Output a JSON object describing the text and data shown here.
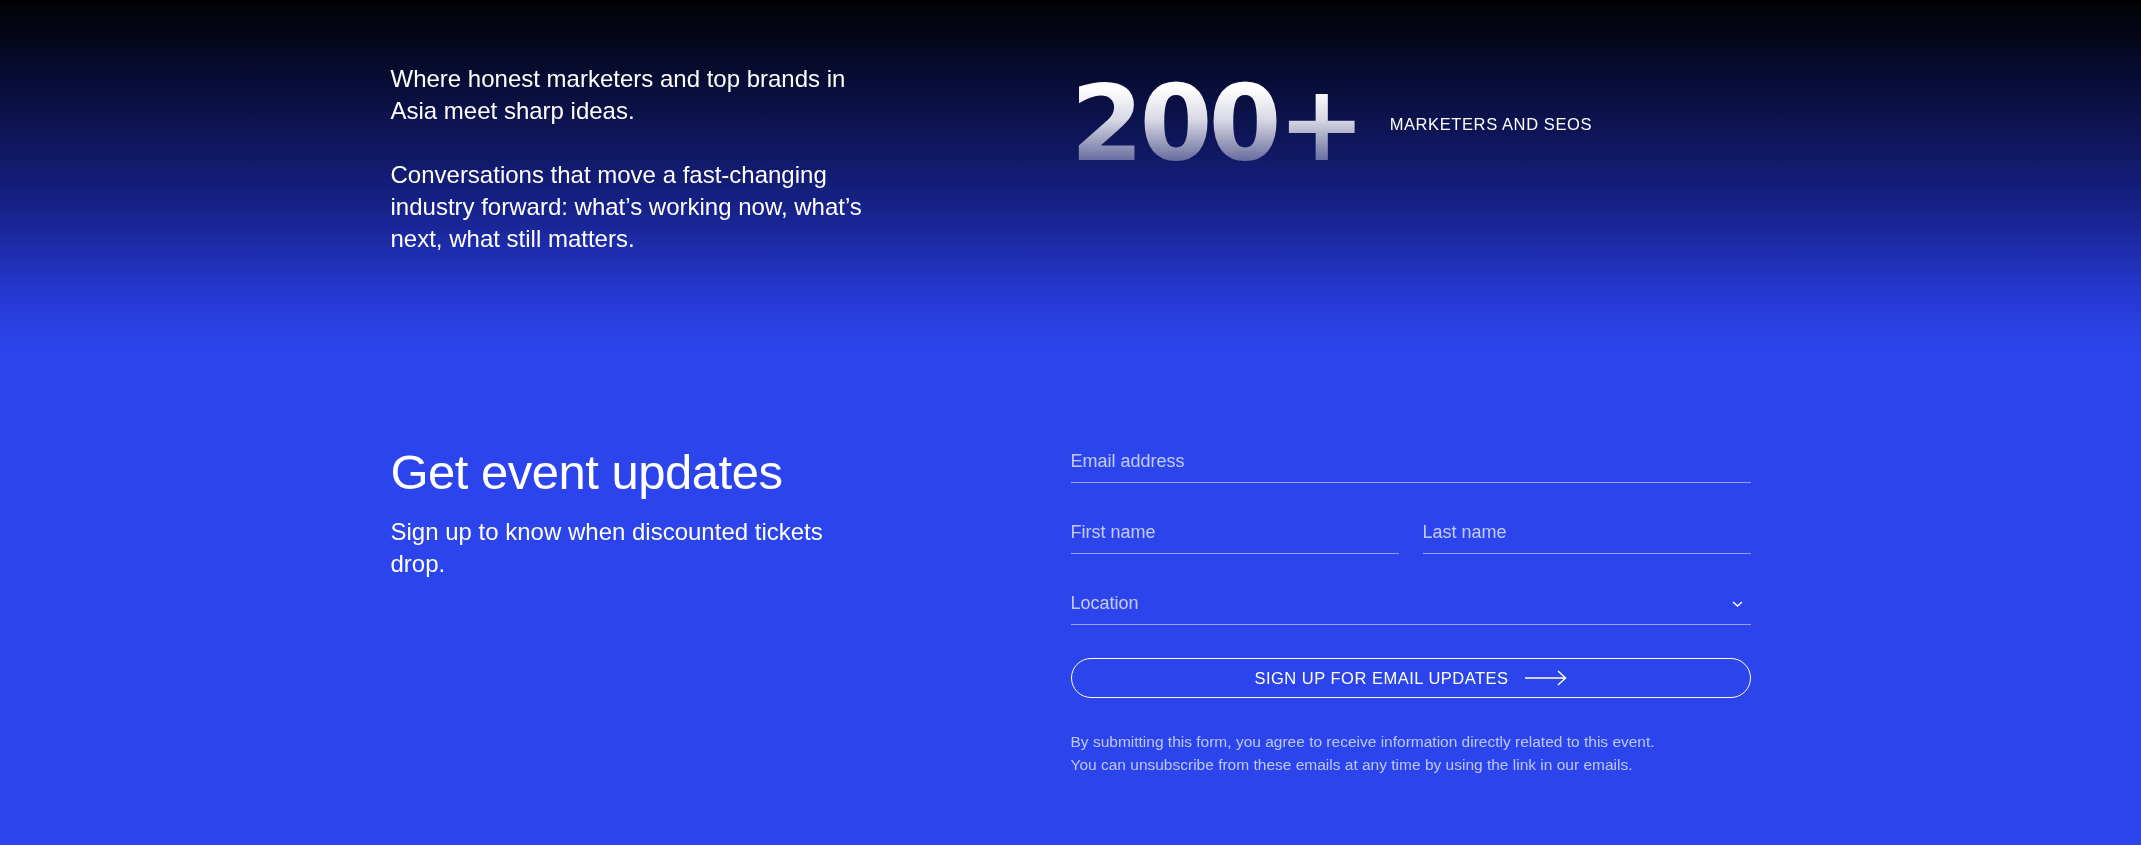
{
  "intro": {
    "paragraphs": [
      "Where honest marketers and top brands in Asia meet sharp ideas.",
      "Conversations that move a fast-changing industry forward: what’s working now, what’s next, what still matters."
    ]
  },
  "stat": {
    "value": "200+",
    "label": "MARKETERS AND SEOS"
  },
  "signup": {
    "title": "Get event updates",
    "subtitle": "Sign up to know when discounted tickets drop."
  },
  "form": {
    "rows": [
      {
        "fields": [
          {
            "kind": "input",
            "placeholder": "Email address"
          }
        ]
      },
      {
        "fields": [
          {
            "kind": "input",
            "placeholder": "First name"
          },
          {
            "kind": "input",
            "placeholder": "Last name"
          }
        ]
      },
      {
        "fields": [
          {
            "kind": "select",
            "placeholder": "Location"
          }
        ]
      }
    ],
    "submit": {
      "label": "SIGN UP FOR EMAIL UPDATES"
    },
    "disclaimer": [
      "By submitting this form, you agree to receive information directly related to this event.",
      "You can unsubscribe from these emails at any time by using the link in our emails."
    ]
  }
}
